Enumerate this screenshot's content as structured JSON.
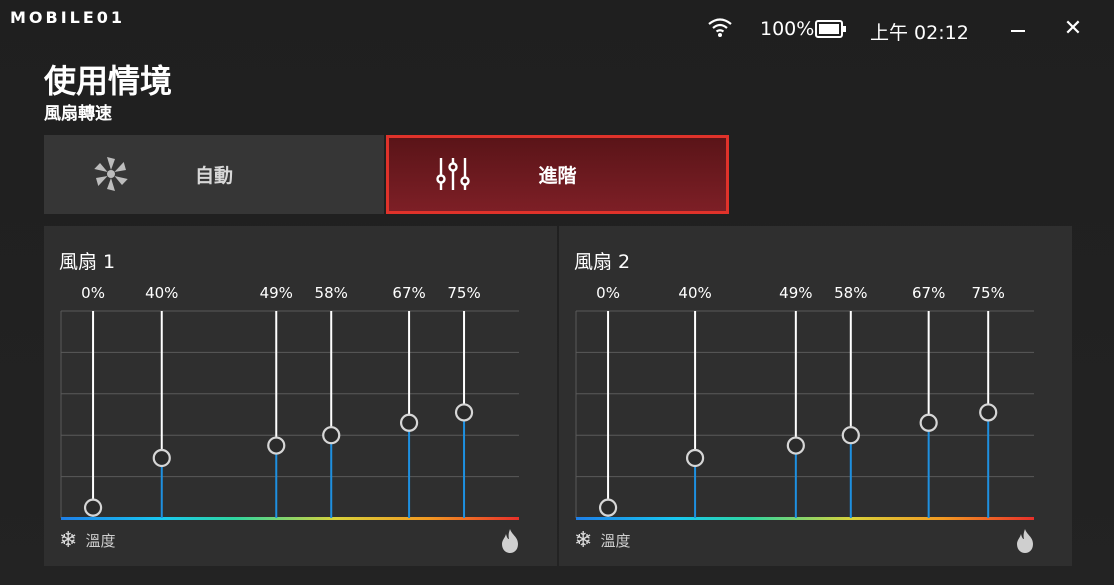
{
  "app": {
    "logo_text": "MOBILE01"
  },
  "status": {
    "battery_percent": "100%",
    "time": "上午 02:12"
  },
  "window_controls": {
    "minimize_icon": "minimize-icon",
    "close_label": "✕"
  },
  "page": {
    "title": "使用情境",
    "subtitle": "風扇轉速"
  },
  "tabs": [
    {
      "label": "自動",
      "icon": "fan-icon",
      "selected": false
    },
    {
      "label": "進階",
      "icon": "sliders-icon",
      "selected": true
    }
  ],
  "temperature_label": "溫度",
  "fans": [
    {
      "label": "風扇 1",
      "points": [
        {
          "pct_label": "0%",
          "temp": 0.07,
          "speed": 0.05
        },
        {
          "pct_label": "40%",
          "temp": 0.22,
          "speed": 0.29
        },
        {
          "pct_label": "49%",
          "temp": 0.47,
          "speed": 0.35
        },
        {
          "pct_label": "58%",
          "temp": 0.59,
          "speed": 0.4
        },
        {
          "pct_label": "67%",
          "temp": 0.76,
          "speed": 0.46
        },
        {
          "pct_label": "75%",
          "temp": 0.88,
          "speed": 0.51
        }
      ]
    },
    {
      "label": "風扇 2",
      "points": [
        {
          "pct_label": "0%",
          "temp": 0.07,
          "speed": 0.05
        },
        {
          "pct_label": "40%",
          "temp": 0.26,
          "speed": 0.29
        },
        {
          "pct_label": "49%",
          "temp": 0.48,
          "speed": 0.35
        },
        {
          "pct_label": "58%",
          "temp": 0.6,
          "speed": 0.4
        },
        {
          "pct_label": "67%",
          "temp": 0.77,
          "speed": 0.46
        },
        {
          "pct_label": "75%",
          "temp": 0.9,
          "speed": 0.51
        }
      ]
    }
  ],
  "colors": {
    "accent_red": "#e0322a",
    "slider_blue": "#1e90e0",
    "knob": "#2a2a2a"
  }
}
